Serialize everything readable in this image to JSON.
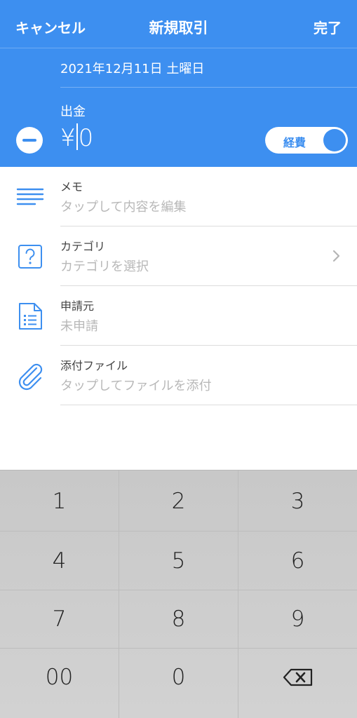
{
  "nav": {
    "cancel": "キャンセル",
    "title": "新規取引",
    "done": "完了"
  },
  "transaction": {
    "date": "2021年12月11日 土曜日",
    "type": "出金",
    "currency": "¥",
    "amount": "0",
    "expense_toggle": "経費",
    "expense_on": true
  },
  "fields": [
    {
      "title": "メモ",
      "value": "タップして内容を編集",
      "icon": "memo-lines-icon"
    },
    {
      "title": "カテゴリ",
      "value": "カテゴリを選択",
      "icon": "question-box-icon"
    },
    {
      "title": "申請元",
      "value": "未申請",
      "icon": "document-list-icon"
    },
    {
      "title": "添付ファイル",
      "value": "タップしてファイルを添付",
      "icon": "paperclip-icon"
    }
  ],
  "keypad": {
    "keys": [
      "1",
      "2",
      "3",
      "4",
      "5",
      "6",
      "7",
      "8",
      "9",
      "00",
      "0"
    ],
    "delete_icon": "backspace-icon"
  },
  "colors": {
    "accent": "#3d8ff0",
    "keypad_bg": "#cccccc"
  }
}
